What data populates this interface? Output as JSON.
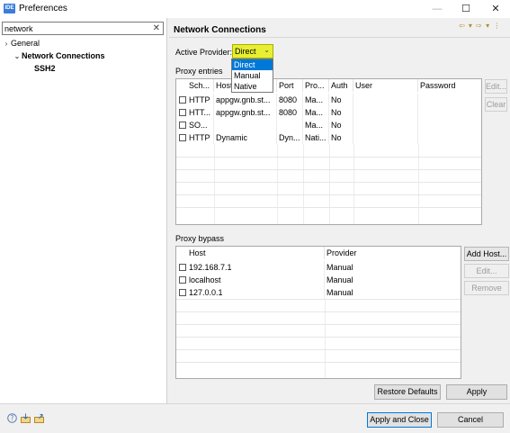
{
  "window": {
    "app_icon": "IDE",
    "title": "Preferences",
    "controls": [
      "—",
      "☐",
      "✕"
    ]
  },
  "filter": {
    "value": "network",
    "clear_icon": "✕"
  },
  "tree": [
    {
      "label": "General",
      "twisty": "›",
      "level": 0,
      "bold": false
    },
    {
      "label": "Network Connections",
      "twisty": "⌄",
      "level": 1,
      "bold": true
    },
    {
      "label": "SSH2",
      "twisty": "",
      "level": 2,
      "bold": true
    }
  ],
  "page": {
    "title": "Network Connections",
    "nav_arrows": "⇦ ▾ ⇨ ▾ ⋮"
  },
  "provider": {
    "label": "Active Provider:",
    "selected": "Direct",
    "options": [
      "Direct",
      "Manual",
      "Native"
    ],
    "highlighted_option": "Direct",
    "highlight_color": "#e8ef32"
  },
  "proxy_entries": {
    "label": "Proxy entries",
    "columns": [
      "Sch...",
      "Host",
      "Port",
      "Pro...",
      "Auth",
      "User",
      "Password"
    ],
    "rows": [
      [
        "HTTP",
        "appgw.gnb.st...",
        "8080",
        "Ma...",
        "No",
        "",
        ""
      ],
      [
        "HTT...",
        "appgw.gnb.st...",
        "8080",
        "Ma...",
        "No",
        "",
        ""
      ],
      [
        "SO...",
        "",
        "",
        "Ma...",
        "No",
        "",
        ""
      ],
      [
        "HTTP",
        "Dynamic",
        "Dyn...",
        "Nati...",
        "No",
        "",
        ""
      ]
    ],
    "buttons": {
      "edit": "Edit...",
      "clear": "Clear"
    }
  },
  "proxy_bypass": {
    "label": "Proxy bypass",
    "columns": [
      "Host",
      "Provider"
    ],
    "rows": [
      [
        "192.168.7.1",
        "Manual"
      ],
      [
        "localhost",
        "Manual"
      ],
      [
        "127.0.0.1",
        "Manual"
      ]
    ],
    "buttons": {
      "add_host": "Add Host...",
      "edit": "Edit...",
      "remove": "Remove"
    }
  },
  "page_buttons": {
    "restore_defaults": "Restore Defaults",
    "apply": "Apply"
  },
  "footer": {
    "icons": [
      "help-icon",
      "import-icon",
      "export-icon"
    ],
    "apply_and_close": "Apply and Close",
    "cancel": "Cancel"
  }
}
